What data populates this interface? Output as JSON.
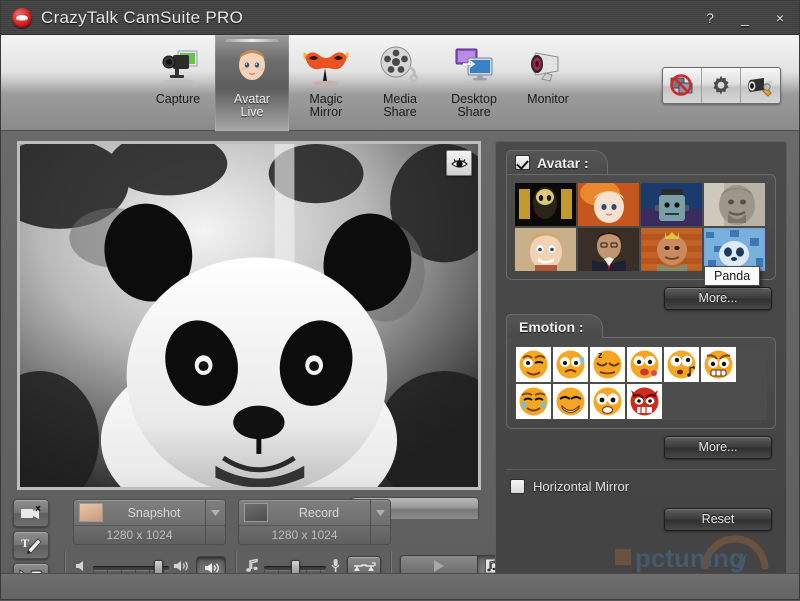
{
  "window": {
    "title": "CrazyTalk CamSuite PRO",
    "logo_icon": "crazytalk-lips-logo",
    "controls": [
      {
        "name": "help",
        "glyph": "?"
      },
      {
        "name": "minimize",
        "glyph": "_"
      },
      {
        "name": "close",
        "glyph": "×"
      }
    ]
  },
  "toolbar": {
    "tabs": [
      {
        "id": "capture",
        "label": "Capture",
        "line2": "",
        "icon": "camcorder-photo-icon",
        "selected": false
      },
      {
        "id": "avatar-live",
        "label": "Avatar",
        "line2": "Live",
        "icon": "baby-face-icon",
        "selected": true
      },
      {
        "id": "magic-mirror",
        "label": "Magic",
        "line2": "Mirror",
        "icon": "carnival-mask-icon",
        "selected": false
      },
      {
        "id": "media-share",
        "label": "Media",
        "line2": "Share",
        "icon": "film-reel-icon",
        "selected": false
      },
      {
        "id": "desktop-share",
        "label": "Desktop",
        "line2": "Share",
        "icon": "two-monitors-icon",
        "selected": false
      },
      {
        "id": "monitor",
        "label": "Monitor",
        "line2": "",
        "icon": "webcam-icon",
        "selected": false
      }
    ],
    "utilities": [
      {
        "id": "disable-output",
        "icon": "no-screen-icon",
        "tooltip": ""
      },
      {
        "id": "settings",
        "icon": "gear-icon",
        "tooltip": ""
      },
      {
        "id": "camera-setup",
        "icon": "camera-wrench-icon",
        "tooltip": ""
      }
    ]
  },
  "preview": {
    "eye_button_icon": "eye-icon",
    "subject": "panda",
    "side_tools": [
      {
        "id": "video-effect",
        "icon": "camcorder-effect-icon"
      },
      {
        "id": "text-draw",
        "icon": "text-pen-icon"
      },
      {
        "id": "emoticon",
        "icon": "cursor-smiley-icon"
      }
    ]
  },
  "capture_controls": {
    "snapshot": {
      "label": "Snapshot",
      "resolution": "1280 x 1024",
      "thumb_icon": "baby-photo-icon",
      "dropdown_icon": "chevron-down-icon"
    },
    "record": {
      "label": "Record",
      "resolution": "1280 x 1024",
      "thumb_icon": "baby-video-icon",
      "dropdown_icon": "chevron-down-icon"
    }
  },
  "audio_controls": {
    "volume": {
      "icon_left": "speaker-low-icon",
      "icon_right": "speaker-waves-icon",
      "value_percent": 80
    },
    "speaker_toggle": {
      "icon": "speaker-icon",
      "pressed": true
    },
    "music": {
      "icon_left": "music-note-icon",
      "icon_right": "microphone-icon",
      "value_percent": 50
    },
    "voice_changer": {
      "icon": "voice-changer-icon",
      "pressed": false
    },
    "play": {
      "icon": "play-triangle-icon"
    },
    "media_file": {
      "icon": "music-file-icon"
    }
  },
  "avatar_panel": {
    "title": "Avatar :",
    "enabled": true,
    "more_label": "More...",
    "tooltip": "Panda",
    "thumbnails": [
      {
        "id": "alien-gold",
        "name": "Gold Alien",
        "selected": false
      },
      {
        "id": "doll",
        "name": "Porcelain Doll",
        "selected": false
      },
      {
        "id": "frankenstein",
        "name": "Frankenstein",
        "selected": false
      },
      {
        "id": "stone-king",
        "name": "Stone King",
        "selected": false
      },
      {
        "id": "puppet-boy",
        "name": "Puppet Boy",
        "selected": false
      },
      {
        "id": "businessman",
        "name": "Businessman",
        "selected": false
      },
      {
        "id": "king-ogre",
        "name": "King Ogre",
        "selected": false
      },
      {
        "id": "panda",
        "name": "Panda",
        "selected": true
      }
    ]
  },
  "emotion_panel": {
    "title": "Emotion :",
    "more_label": "More...",
    "emoticons": [
      {
        "id": "angry-wink",
        "name": "Angry Wink"
      },
      {
        "id": "worried",
        "name": "Worried"
      },
      {
        "id": "sleepy",
        "name": "Sleepy"
      },
      {
        "id": "kiss",
        "name": "Kiss"
      },
      {
        "id": "whistle",
        "name": "Whistle"
      },
      {
        "id": "grin-angry",
        "name": "Angry Grin"
      },
      {
        "id": "crying",
        "name": "Crying"
      },
      {
        "id": "smile",
        "name": "Smile"
      },
      {
        "id": "surprised",
        "name": "Surprised"
      },
      {
        "id": "devil",
        "name": "Devil"
      }
    ]
  },
  "options": {
    "horizontal_mirror": {
      "label": "Horizontal Mirror",
      "checked": false
    },
    "reset_label": "Reset"
  },
  "watermark": {
    "text": "pctuning"
  }
}
